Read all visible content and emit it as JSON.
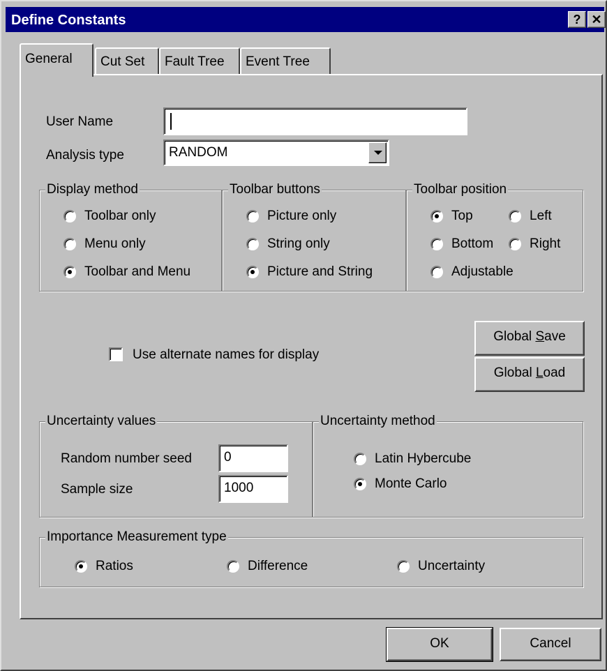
{
  "window": {
    "title": "Define Constants",
    "help_label": "?",
    "close_label": "✕",
    "title_bg": "#000080",
    "face_color": "#c0c0c0"
  },
  "tabs": [
    {
      "label": "General",
      "active": true
    },
    {
      "label": "Cut Set",
      "active": false
    },
    {
      "label": "Fault Tree",
      "active": false
    },
    {
      "label": "Event Tree",
      "active": false
    }
  ],
  "general": {
    "user_name": {
      "label": "User Name",
      "value": ""
    },
    "analysis_type": {
      "label": "Analysis type",
      "value": "RANDOM"
    },
    "display_method": {
      "title": "Display method",
      "options": [
        "Toolbar only",
        "Menu only",
        "Toolbar and Menu"
      ],
      "selected": "Toolbar and Menu"
    },
    "toolbar_buttons": {
      "title": "Toolbar buttons",
      "options": [
        "Picture only",
        "String only",
        "Picture and String"
      ],
      "selected": "Picture and String"
    },
    "toolbar_position": {
      "title": "Toolbar position",
      "options": [
        "Top",
        "Left",
        "Bottom",
        "Right",
        "Adjustable"
      ],
      "selected": "Top"
    },
    "alternate_names": {
      "label": "Use alternate names for display",
      "checked": false
    },
    "global_save": {
      "label": "Global Save",
      "mnemonic": "S"
    },
    "global_load": {
      "label": "Global Load",
      "mnemonic": "L"
    },
    "uncertainty_values": {
      "title": "Uncertainty values",
      "seed_label": "Random number seed",
      "seed_value": "0",
      "sample_label": "Sample size",
      "sample_value": "1000"
    },
    "uncertainty_method": {
      "title": "Uncertainty method",
      "options": [
        "Latin Hybercube",
        "Monte Carlo"
      ],
      "selected": "Monte Carlo"
    },
    "importance": {
      "title": "Importance Measurement type",
      "options": [
        "Ratios",
        "Difference",
        "Uncertainty"
      ],
      "selected": "Ratios"
    }
  },
  "footer": {
    "ok_label": "OK",
    "cancel_label": "Cancel"
  }
}
